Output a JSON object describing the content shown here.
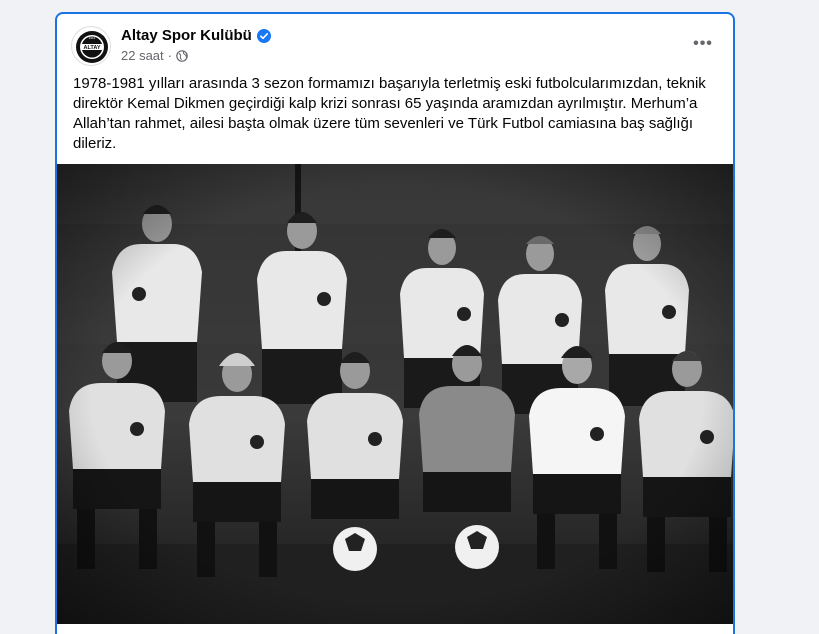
{
  "post": {
    "page_name": "Altay Spor Kulübü",
    "timestamp": "22 saat",
    "separator": "·",
    "privacy_icon": "globe-icon",
    "verified_icon": "verified-badge-icon",
    "more_icon": "more-options-icon",
    "more_label": "•••",
    "avatar": {
      "logo_text": "ALTAY",
      "logo_top_text": "1914",
      "icon": "altay-logo-icon"
    },
    "text": "1978-1981 yılları arasında 3 sezon formamızı başarıyla terletmiş eski futbolcularımızdan, teknik direktör Kemal Dikmen geçirdiği kalp krizi sonrası 65 yaşında aramızdan ayrılmıştır. Merhum’a Allah’tan rahmet, ailesi başta olmak üzere tüm sevenleri ve Türk Futbol camiasına baş sağlığı dileriz.",
    "photo": {
      "kind": "black-and-white team photo",
      "players_back_row": 5,
      "players_front_row": 6
    }
  },
  "colors": {
    "accent_border": "#1b74e4",
    "verified_blue": "#1877f2",
    "text_primary": "#050505",
    "text_secondary": "#65676b",
    "like_blue": "#1877f2",
    "love_red": "#f33e58",
    "care_yellow": "#f7b125"
  }
}
